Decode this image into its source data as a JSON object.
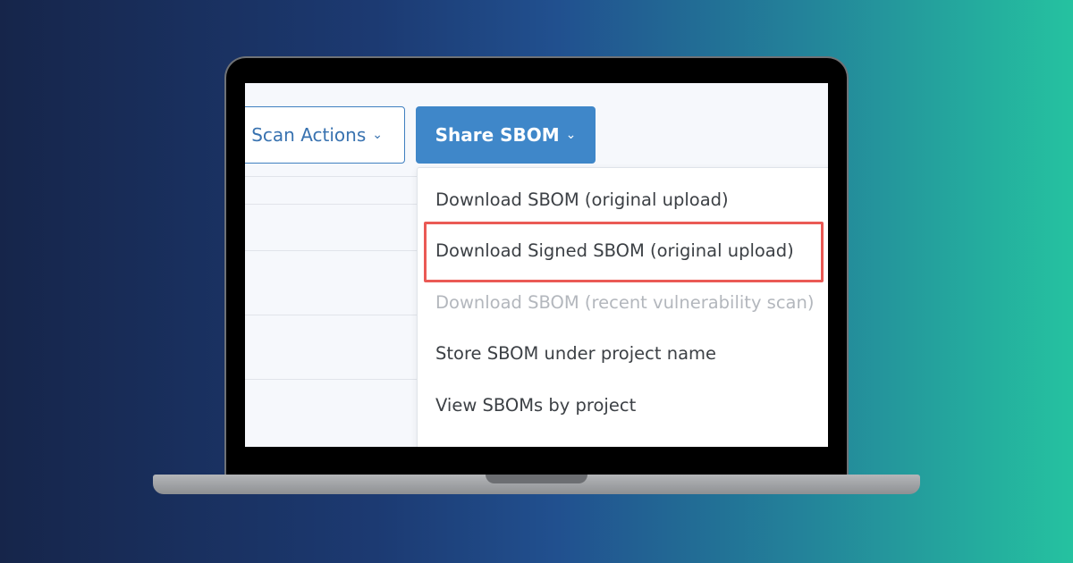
{
  "toolbar": {
    "scan_actions_label": "Scan Actions",
    "share_sbom_label": "Share SBOM",
    "chevron": "⌄"
  },
  "menu": {
    "items": [
      {
        "label": "Download SBOM (original upload)",
        "enabled": true
      },
      {
        "label": "Download Signed SBOM (original upload)",
        "enabled": true,
        "highlighted": true
      },
      {
        "label": "Download SBOM (recent vulnerability scan)",
        "enabled": false
      },
      {
        "label": "Store SBOM under project name",
        "enabled": true
      },
      {
        "label": "View SBOMs by project",
        "enabled": true
      }
    ]
  },
  "colors": {
    "primary": "#3f87c9",
    "highlight": "#ea5a55",
    "disabled_text": "#b3b7bd"
  }
}
